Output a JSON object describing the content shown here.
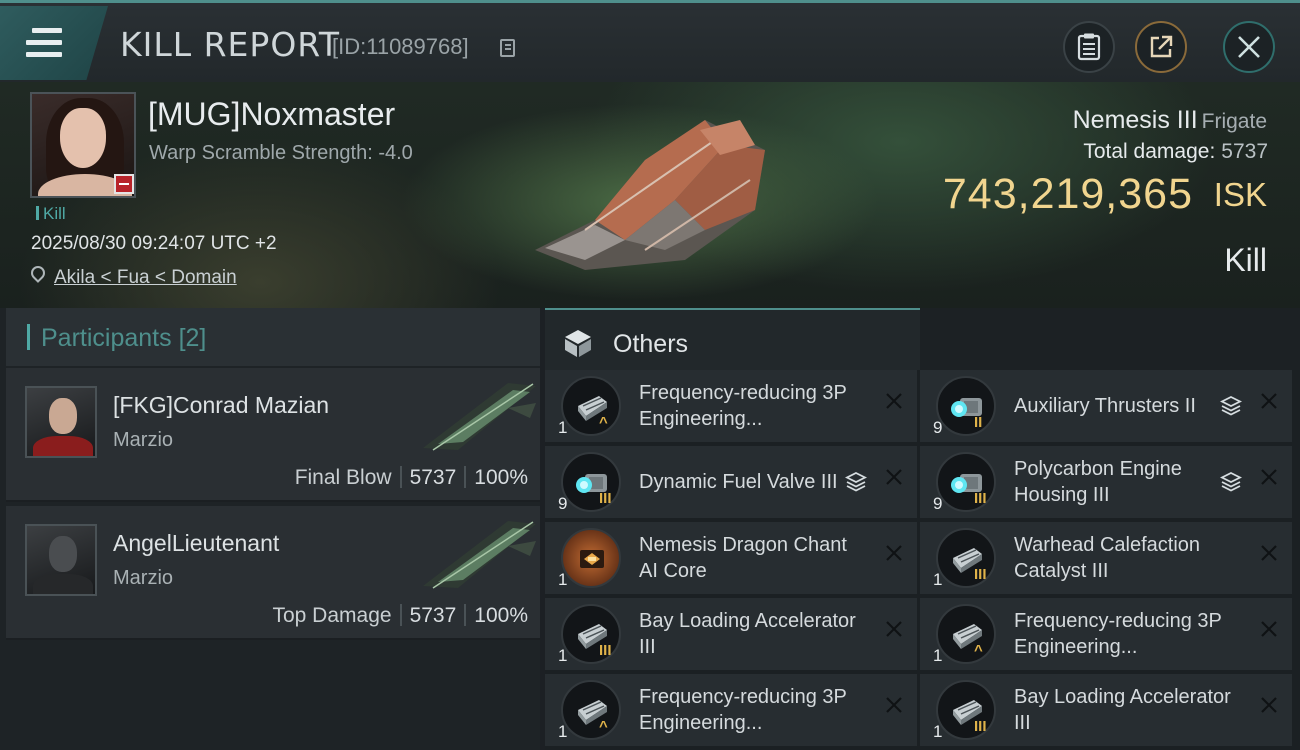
{
  "header": {
    "title": "KILL REPORT",
    "report_id": "[ID:11089768]"
  },
  "victim": {
    "name": "[MUG]Noxmaster",
    "warp_scramble": "Warp Scramble Strength: -4.0",
    "kill_tag": "Kill",
    "datetime": "2025/08/30 09:24:07 UTC +2",
    "location": "Akila < Fua < Domain"
  },
  "summary": {
    "ship_name": "Nemesis III",
    "ship_class": "Frigate",
    "damage_label": "Total damage:",
    "damage_value": "5737",
    "isk_value": "743,219,365",
    "isk_unit": "ISK",
    "outcome": "Kill"
  },
  "participants": {
    "label": "Participants",
    "count": "[2]",
    "list": [
      {
        "name": "[FKG]Conrad Mazian",
        "corp": "Marzio",
        "role": "Final Blow",
        "damage": "5737",
        "percent": "100%"
      },
      {
        "name": "AngelLieutenant",
        "corp": "Marzio",
        "role": "Top Damage",
        "damage": "5737",
        "percent": "100%"
      }
    ]
  },
  "others": {
    "label": "Others",
    "items": [
      {
        "name": "Frequency-reducing 3P Engineering...",
        "qty": "1",
        "meta": "^",
        "icon": "engineering-module-icon"
      },
      {
        "name": "Auxiliary Thrusters II",
        "qty": "9",
        "meta": "II",
        "icon": "thruster-icon"
      },
      {
        "name": "Dynamic Fuel Valve III",
        "qty": "9",
        "meta": "III",
        "icon": "thruster-icon"
      },
      {
        "name": "Polycarbon Engine Housing III",
        "qty": "9",
        "meta": "III",
        "icon": "thruster-icon"
      },
      {
        "name": "Nemesis Dragon Chant AI Core",
        "qty": "1",
        "meta": "",
        "icon": "ai-core-icon"
      },
      {
        "name": "Warhead Calefaction Catalyst III",
        "qty": "1",
        "meta": "III",
        "icon": "engineering-module-icon"
      },
      {
        "name": "Bay Loading Accelerator III",
        "qty": "1",
        "meta": "III",
        "icon": "engineering-module-icon"
      },
      {
        "name": "Frequency-reducing 3P Engineering...",
        "qty": "1",
        "meta": "^",
        "icon": "engineering-module-icon"
      },
      {
        "name": "Frequency-reducing 3P Engineering...",
        "qty": "1",
        "meta": "^",
        "icon": "engineering-module-icon"
      },
      {
        "name": "Bay Loading Accelerator III",
        "qty": "1",
        "meta": "III",
        "icon": "engineering-module-icon"
      }
    ]
  },
  "colors": {
    "accent_teal": "#4fa9a5",
    "isk_gold": "#f1d58f",
    "meta_gold": "#e0b34a"
  }
}
